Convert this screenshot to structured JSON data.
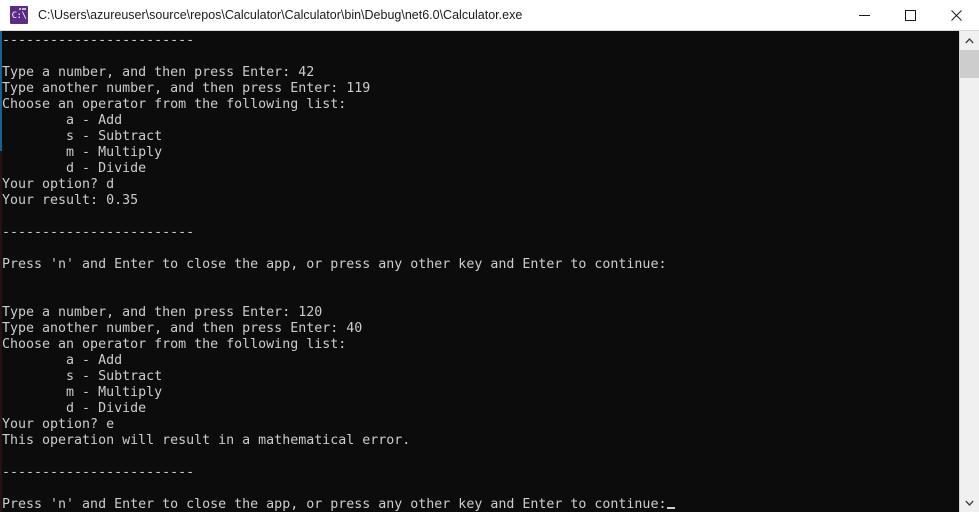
{
  "window": {
    "title": "C:\\Users\\azureuser\\source\\repos\\Calculator\\Calculator\\bin\\Debug\\net6.0\\Calculator.exe",
    "icon": "console-app-icon",
    "icon_glyph": "C:\\",
    "colors": {
      "titlebar_background": "#ffffff",
      "titlebar_text": "#1a1a1a",
      "console_background": "#0c0c0c",
      "console_text": "#cccccc",
      "icon_background": "#5a2d82",
      "scrollbar_track": "#f0f0f0",
      "scrollbar_thumb": "#cdcdcd",
      "window_edge_accent": "#17638c"
    },
    "controls": {
      "minimize": "Minimize",
      "maximize": "Maximize",
      "close": "Close"
    }
  },
  "scrollbar": {
    "up_arrow_label": "Scroll up",
    "down_arrow_label": "Scroll down",
    "thumb_label": "Scroll thumb"
  },
  "console": {
    "prompt_cursor": "_",
    "lines": [
      "------------------------",
      "",
      "Type a number, and then press Enter: 42",
      "Type another number, and then press Enter: 119",
      "Choose an operator from the following list:",
      "        a - Add",
      "        s - Subtract",
      "        m - Multiply",
      "        d - Divide",
      "Your option? d",
      "Your result: 0.35",
      "",
      "------------------------",
      "",
      "Press 'n' and Enter to close the app, or press any other key and Enter to continue:",
      "",
      "",
      "Type a number, and then press Enter: 120",
      "Type another number, and then press Enter: 40",
      "Choose an operator from the following list:",
      "        a - Add",
      "        s - Subtract",
      "        m - Multiply",
      "        d - Divide",
      "Your option? e",
      "This operation will result in a mathematical error.",
      "",
      "------------------------",
      "",
      "Press 'n' and Enter to close the app, or press any other key and Enter to continue:"
    ],
    "cursor_line_index": 29
  }
}
